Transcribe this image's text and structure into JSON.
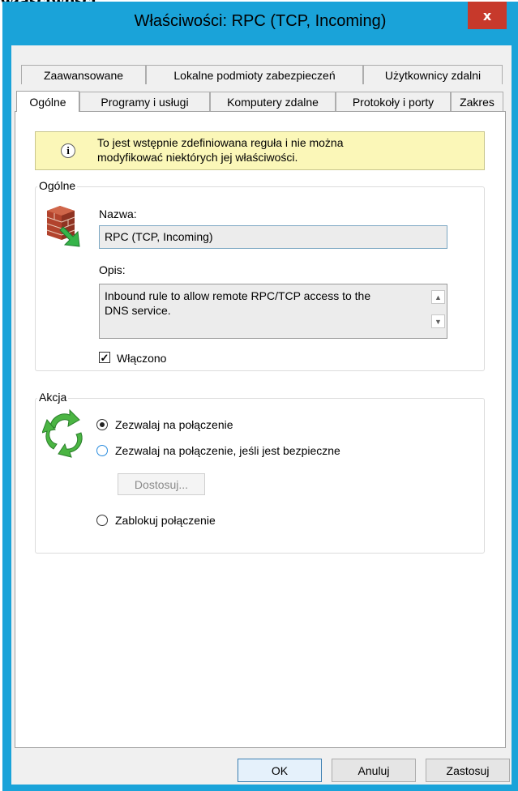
{
  "background_text": "właściwości.",
  "window": {
    "title": "Właściwości: RPC (TCP, Incoming)",
    "close_label": "x",
    "accent_color": "#1aa3d9"
  },
  "tabs": {
    "row1": [
      "Zaawansowane",
      "Lokalne podmioty zabezpieczeń",
      "Użytkownicy zdalni"
    ],
    "row2": [
      "Ogólne",
      "Programy i usługi",
      "Komputery zdalne",
      "Protokoły i porty",
      "Zakres"
    ],
    "active": "Ogólne"
  },
  "info": {
    "icon": "info-icon",
    "line1": "To jest wstępnie zdefiniowana reguła i nie można",
    "line2": "modyfikować niektórych jej właściwości."
  },
  "general": {
    "group_label": "Ogólne",
    "icon": "firewall-icon",
    "name_label": "Nazwa:",
    "name_value": "RPC (TCP, Incoming)",
    "desc_label": "Opis:",
    "desc_line1": "Inbound rule to allow remote RPC/TCP access to the",
    "desc_line2": "DNS service.",
    "enabled_label": "Włączono",
    "enabled": true
  },
  "action": {
    "group_label": "Akcja",
    "icon": "action-arrows-icon",
    "options": [
      {
        "label": "Zezwalaj na połączenie",
        "checked": true
      },
      {
        "label": "Zezwalaj na połączenie, jeśli jest bezpieczne",
        "checked": false
      },
      {
        "label": "Zablokuj połączenie",
        "checked": false
      }
    ],
    "customize_label": "Dostosuj..."
  },
  "buttons": {
    "ok": "OK",
    "cancel": "Anuluj",
    "apply": "Zastosuj"
  }
}
